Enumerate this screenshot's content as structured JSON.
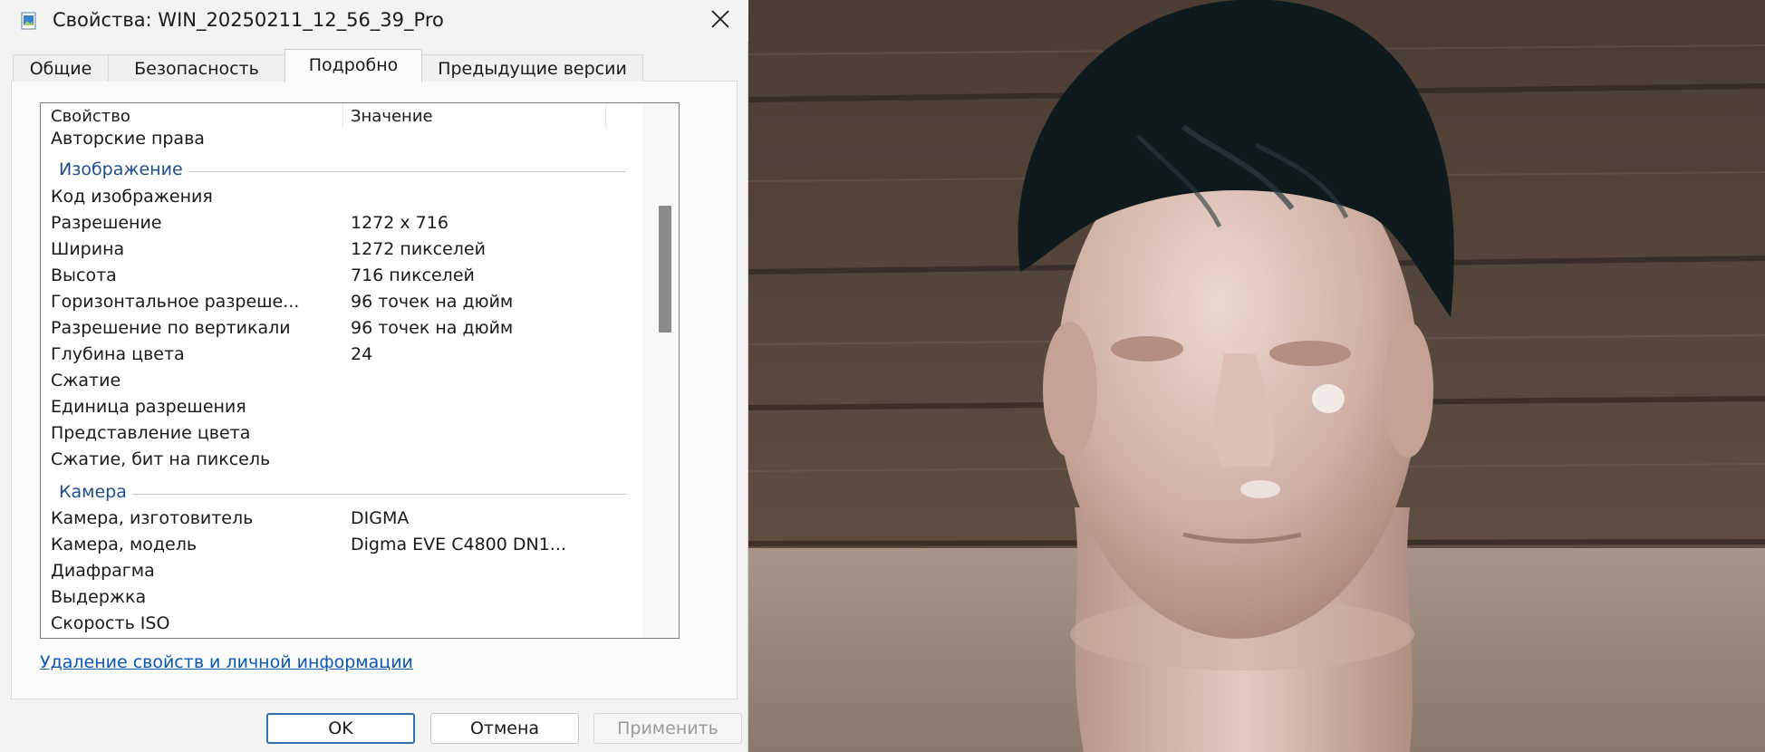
{
  "dialog": {
    "title": "Свойства: WIN_20250211_12_56_39_Pro",
    "tabs": [
      "Общие",
      "Безопасность",
      "Подробно",
      "Предыдущие версии"
    ],
    "active_tab": "Подробно",
    "columns": {
      "property": "Свойство",
      "value": "Значение"
    },
    "rows_top": [
      {
        "k": "Авторские права",
        "v": ""
      }
    ],
    "group_image": "Изображение",
    "rows_image": [
      {
        "k": "Код изображения",
        "v": ""
      },
      {
        "k": "Разрешение",
        "v": "1272 x 716"
      },
      {
        "k": "Ширина",
        "v": "1272 пикселей"
      },
      {
        "k": "Высота",
        "v": "716 пикселей"
      },
      {
        "k": "Горизонтальное разреше...",
        "v": "96 точек на дюйм"
      },
      {
        "k": "Разрешение по вертикали",
        "v": "96 точек на дюйм"
      },
      {
        "k": "Глубина цвета",
        "v": "24"
      },
      {
        "k": "Сжатие",
        "v": ""
      },
      {
        "k": "Единица разрешения",
        "v": ""
      },
      {
        "k": "Представление цвета",
        "v": ""
      },
      {
        "k": "Сжатие, бит на пиксель",
        "v": ""
      }
    ],
    "group_camera": "Камера",
    "rows_camera": [
      {
        "k": "Камера, изготовитель",
        "v": "DIGMA"
      },
      {
        "k": "Камера, модель",
        "v": "Digma EVE C4800 DN1..."
      },
      {
        "k": "Диафрагма",
        "v": ""
      },
      {
        "k": "Выдержка",
        "v": ""
      },
      {
        "k": "Скорость ISO",
        "v": ""
      }
    ],
    "remove_link": "Удаление свойств и личной информации",
    "buttons": {
      "ok": "OK",
      "cancel": "Отмена",
      "apply": "Применить"
    }
  },
  "colors": {
    "group_label": "#1f4e8c",
    "link": "#0b57b3",
    "default_button_border": "#2f6fb5"
  },
  "icons": [
    "image-file-icon",
    "close-icon"
  ]
}
